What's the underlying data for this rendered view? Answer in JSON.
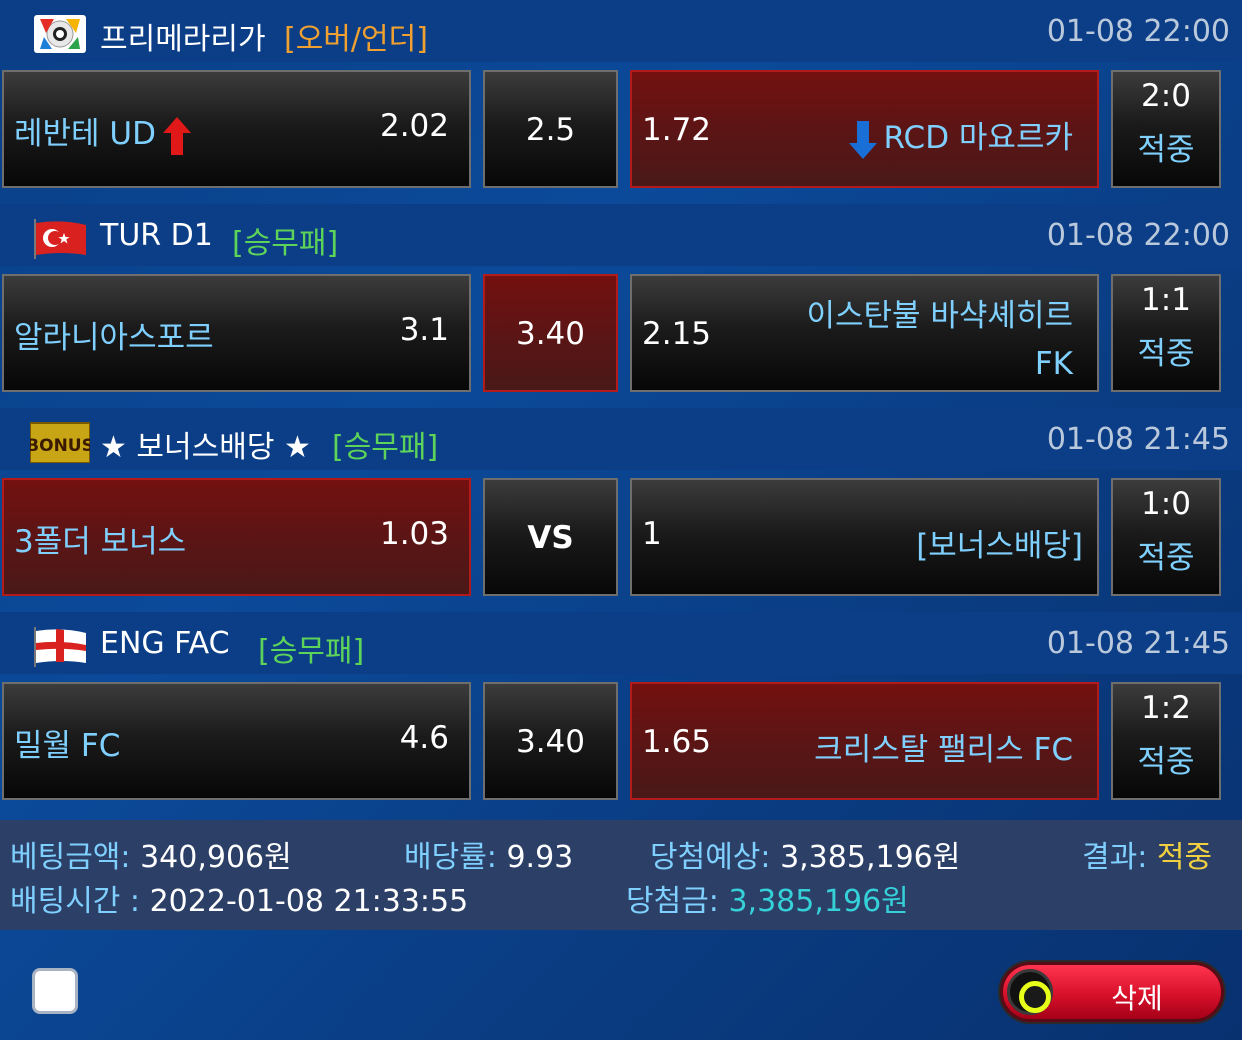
{
  "matches": [
    {
      "league": "프리메라리가",
      "bet_type": "[오버/언더]",
      "time": "01-08 22:00",
      "home": {
        "name": "레반테 UD",
        "odds": "2.02"
      },
      "mid": "2.5",
      "away": {
        "name": "RCD 마요르카",
        "odds": "1.72"
      },
      "selected": "away",
      "score": "2:0",
      "result": "적중"
    },
    {
      "league": "TUR D1",
      "bet_type": "[승무패]",
      "time": "01-08 22:00",
      "home": {
        "name": "알라니아스포르",
        "odds": "3.1"
      },
      "mid": "3.40",
      "away": {
        "name_line1": "이스탄불 바샥셰히르",
        "name_line2": "FK",
        "odds": "2.15"
      },
      "selected": "mid",
      "score": "1:1",
      "result": "적중"
    },
    {
      "league": "★ 보너스배당 ★",
      "bet_type": "[승무패]",
      "time": "01-08 21:45",
      "home": {
        "name": "3폴더 보너스",
        "odds": "1.03"
      },
      "mid": "VS",
      "away": {
        "name": "[보너스배당]",
        "odds": "1"
      },
      "selected": "home",
      "score": "1:0",
      "result": "적중",
      "badge_text": "BONUS"
    },
    {
      "league": "ENG FAC",
      "bet_type": "[승무패]",
      "time": "01-08 21:45",
      "home": {
        "name": "밀월 FC",
        "odds": "4.6"
      },
      "mid": "3.40",
      "away": {
        "name": "크리스탈 팰리스 FC",
        "odds": "1.65"
      },
      "selected": "away",
      "score": "1:2",
      "result": "적중"
    }
  ],
  "summary": {
    "bet_amount_label": "베팅금액:",
    "bet_amount": "340,906원",
    "odds_label": "배당률:",
    "odds": "9.93",
    "expected_label": "당첨예상:",
    "expected": "3,385,196원",
    "result_label": "결과:",
    "result": "적중",
    "bet_time_label": "배팅시간 :",
    "bet_time": "2022-01-08 21:33:55",
    "win_label": "당첨금:",
    "win": "3,385,196원"
  },
  "delete_label": "삭제"
}
